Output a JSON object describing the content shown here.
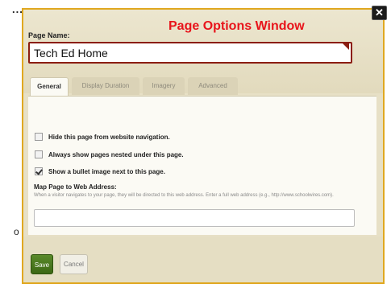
{
  "background": {
    "ellipsis": "...",
    "fragment": "o"
  },
  "dialog": {
    "title": "Page Options Window",
    "close_glyph": "✕",
    "page_name_label": "Page Name:",
    "page_name_value": "Tech Ed Home",
    "tabs": [
      {
        "label": "General",
        "active": true
      },
      {
        "label": "Display Duration",
        "active": false
      },
      {
        "label": "Imagery",
        "active": false
      },
      {
        "label": "Advanced",
        "active": false
      }
    ],
    "options": [
      {
        "label": "Hide this page from website navigation.",
        "checked": false
      },
      {
        "label": "Always show pages nested under this page.",
        "checked": false
      },
      {
        "label": "Show a bullet image next to this page.",
        "checked": true
      }
    ],
    "map": {
      "title": "Map Page to Web Address:",
      "help": "When a visitor navigates to your page, they will be directed to this web address. Enter a full web address (e.g., http://www.schoolwires.com).",
      "value": ""
    },
    "buttons": {
      "save": "Save",
      "cancel": "Cancel"
    },
    "colors": {
      "title": "#e8141b",
      "border": "#e0a820",
      "save": "#3c6814"
    }
  }
}
